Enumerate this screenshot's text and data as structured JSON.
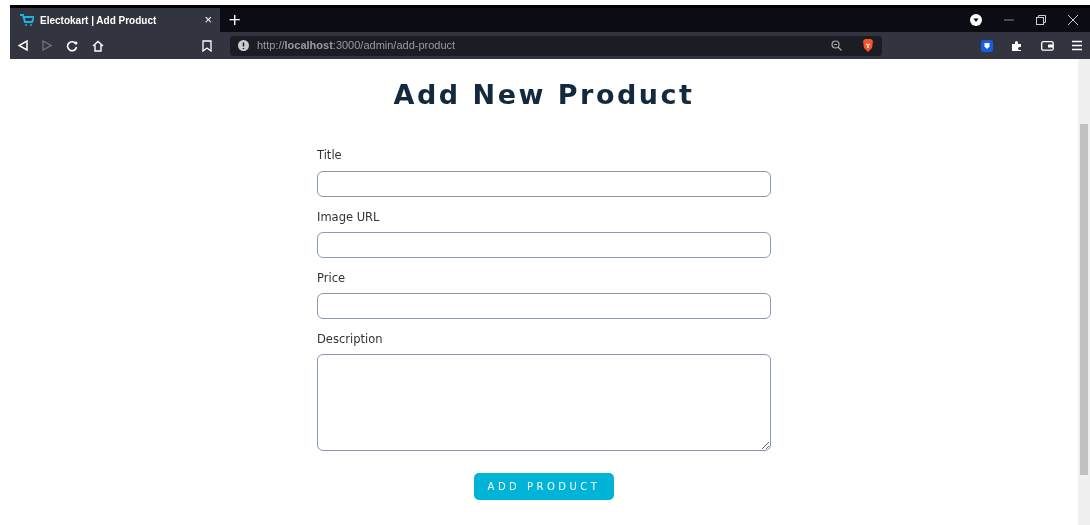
{
  "browser": {
    "tab": {
      "title": "Electokart | Add Product",
      "close": "×"
    },
    "new_tab": "+",
    "url": "http://**localhost**:3000/admin/add-product"
  },
  "heading": "Add New Product",
  "fields": [
    {
      "label": "Title",
      "kind": "input"
    },
    {
      "label": "Image URL",
      "kind": "input"
    },
    {
      "label": "Price",
      "kind": "input"
    },
    {
      "label": "Description",
      "kind": "textarea"
    }
  ],
  "submit": "ADD PRODUCT"
}
